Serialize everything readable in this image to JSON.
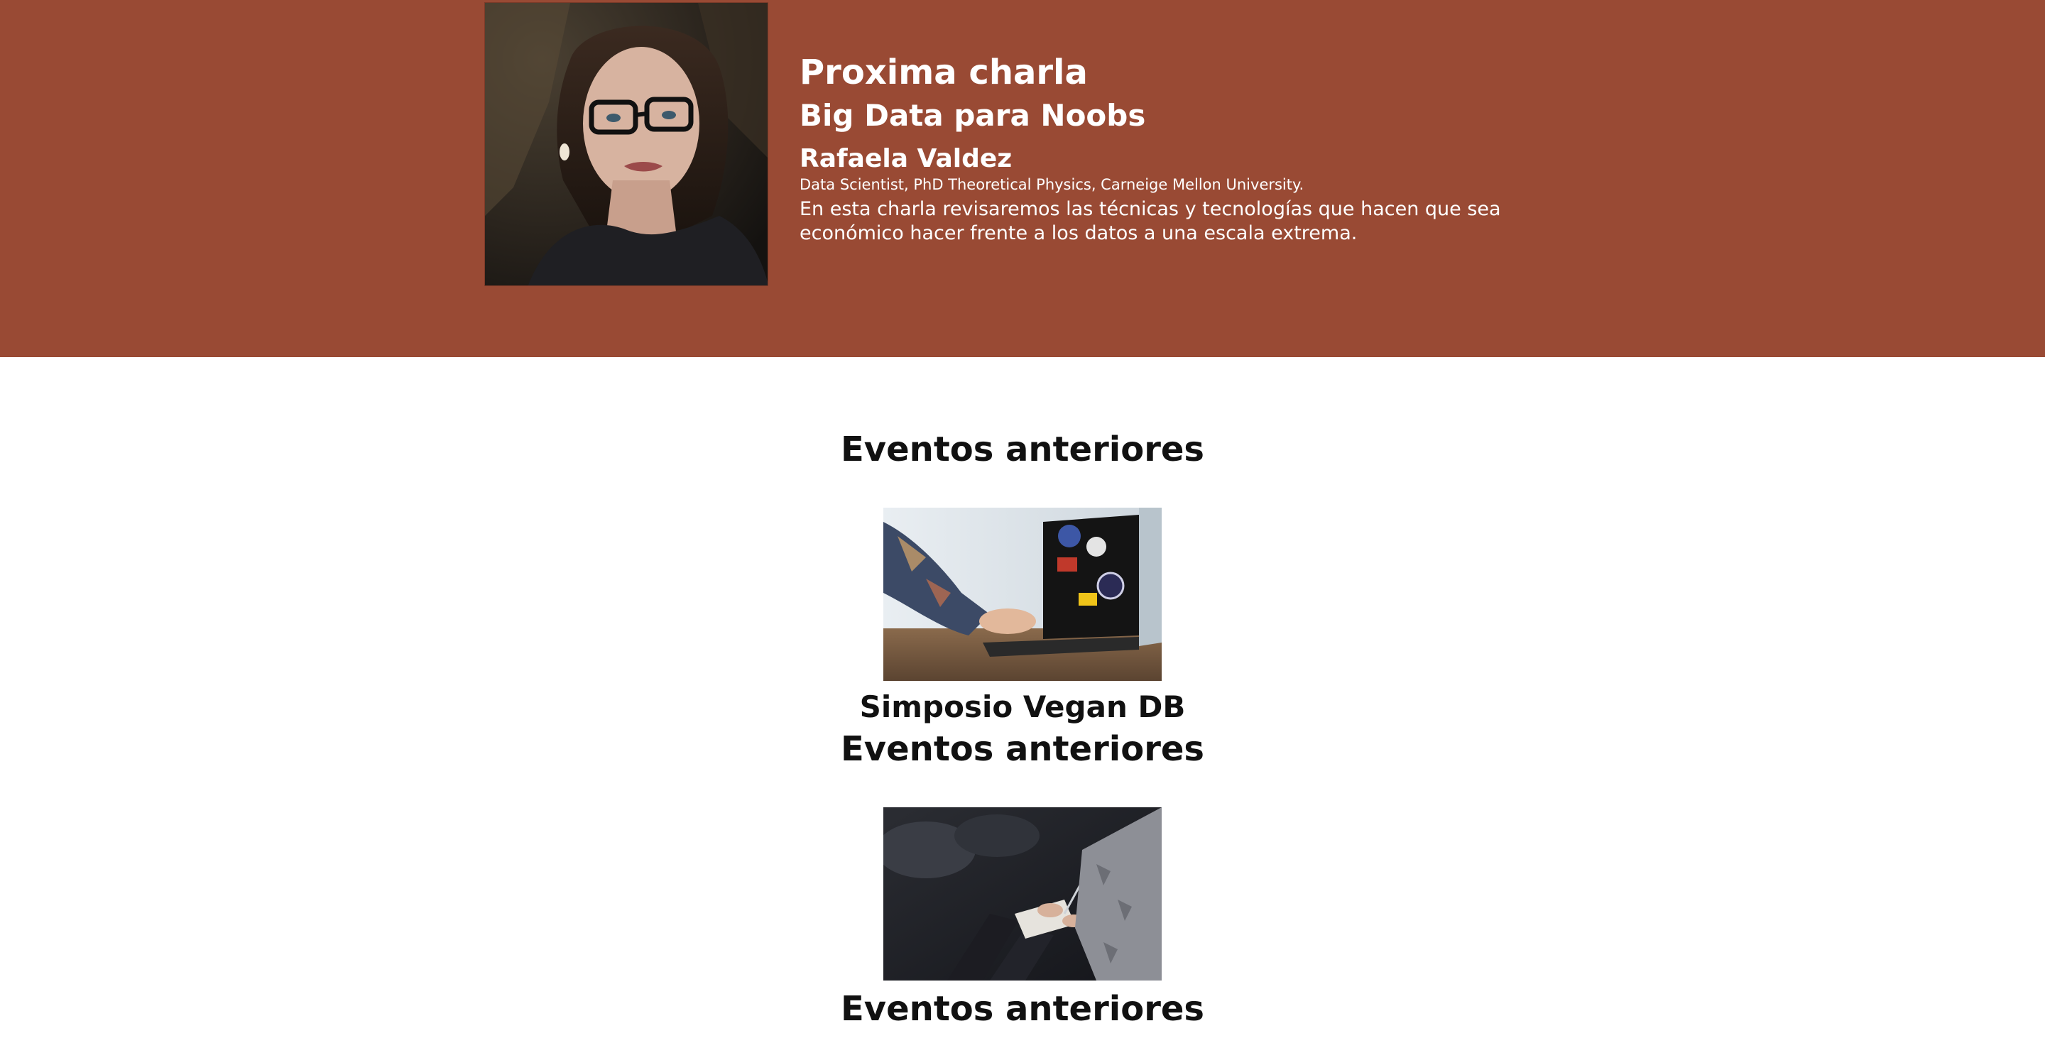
{
  "theme": {
    "hero_background": "#994a34",
    "text_light": "#ffffff",
    "text_dark": "#111111"
  },
  "next_talk": {
    "kicker": "Proxima charla",
    "title": "Big Data para Noobs",
    "speaker_name": "Rafaela Valdez",
    "speaker_credentials": "Data Scientist, PhD Theoretical Physics, Carneige Mellon University.",
    "description": "En esta charla revisaremos las técnicas y tecnologías que hacen que sea económico hacer frente a los datos a una escala extrema.",
    "photo_icon": "speaker-portrait"
  },
  "past_events": {
    "heading_1": "Eventos anteriores",
    "heading_2": "Eventos anteriores",
    "heading_3": "Eventos anteriores",
    "items": [
      {
        "name": "Simposio Vegan DB",
        "photo_icon": "laptop-with-stickers"
      },
      {
        "name": "",
        "photo_icon": "audience-taking-notes"
      }
    ]
  }
}
